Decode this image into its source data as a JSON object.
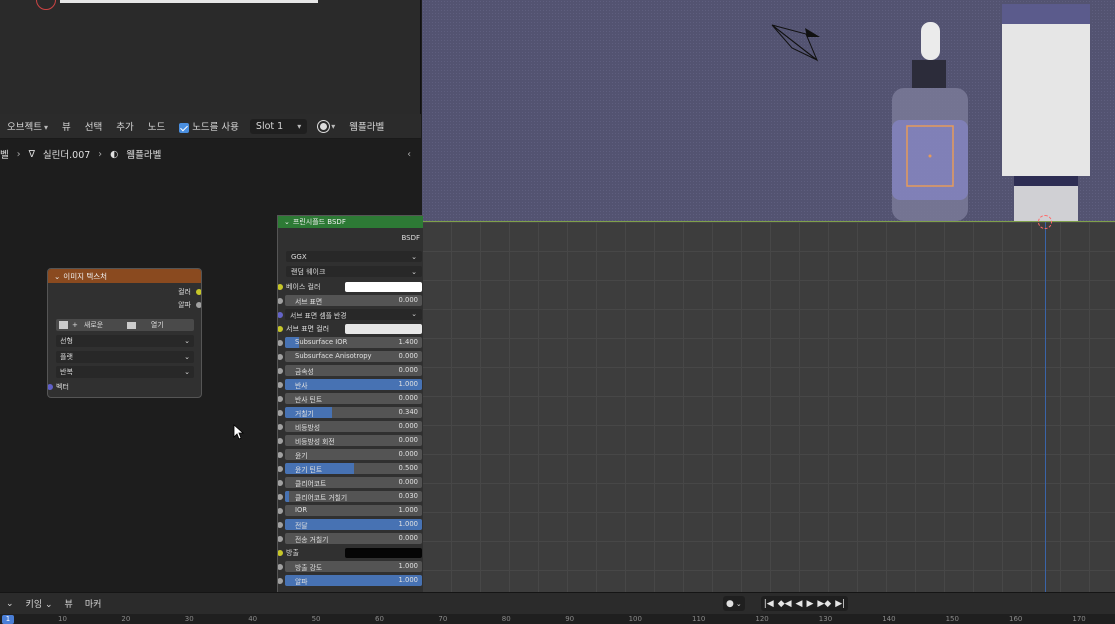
{
  "node_header": {
    "object_label": "오브젝트",
    "view": "뷰",
    "select": "선택",
    "add": "추가",
    "node": "노드",
    "use_nodes": "노드를 사용",
    "slot": "Slot 1",
    "material": "웸플라벨"
  },
  "breadcrumb": {
    "first": "벨",
    "object": "실린더.007",
    "material": "웸플라벨"
  },
  "image_texture_node": {
    "title": "이미지 텍스처",
    "out_color": "컬러",
    "out_alpha": "알파",
    "new_label": "새로운",
    "open_label": "열기",
    "interpolation": "선형",
    "projection": "플랫",
    "extension": "반복",
    "vector": "벡터"
  },
  "bsdf": {
    "title": "프린시플드 BSDF",
    "output": "BSDF",
    "distribution": "GGX",
    "subsurface_method": "랜덤 웨이크",
    "base_color": "베이스 컬러",
    "subsurface": {
      "label": "서브 표면",
      "value": "0.000",
      "fill": 0.0
    },
    "subsurface_radius": "서브 표면 셈플 반경",
    "subsurface_color": "서브 표면 컬러",
    "rows": [
      {
        "label": "Subsurface IOR",
        "value": "1.400",
        "fill": 0.1
      },
      {
        "label": "Subsurface Anisotropy",
        "value": "0.000",
        "fill": 0.0
      },
      {
        "label": "금속성",
        "value": "0.000",
        "fill": 0.0
      },
      {
        "label": "반사",
        "value": "1.000",
        "fill": 1.0
      },
      {
        "label": "반사 틴트",
        "value": "0.000",
        "fill": 0.0
      },
      {
        "label": "거칠기",
        "value": "0.340",
        "fill": 0.34
      },
      {
        "label": "비등방성",
        "value": "0.000",
        "fill": 0.0
      },
      {
        "label": "비등방성 회전",
        "value": "0.000",
        "fill": 0.0
      },
      {
        "label": "윤기",
        "value": "0.000",
        "fill": 0.0
      },
      {
        "label": "윤기 틴트",
        "value": "0.500",
        "fill": 0.5
      },
      {
        "label": "클리어코트",
        "value": "0.000",
        "fill": 0.0
      },
      {
        "label": "클리어코트 거칠기",
        "value": "0.030",
        "fill": 0.03
      },
      {
        "label": "IOR",
        "value": "1.000",
        "fill": 0.0
      },
      {
        "label": "전달",
        "value": "1.000",
        "fill": 1.0
      },
      {
        "label": "전송 거칠기",
        "value": "0.000",
        "fill": 0.0
      }
    ],
    "emission": "방출",
    "emission_strength": {
      "label": "방출 강도",
      "value": "1.000",
      "fill": 0.0
    },
    "alpha": {
      "label": "알파",
      "value": "1.000",
      "fill": 1.0
    }
  },
  "timeline": {
    "keying": "키잉",
    "view": "뷰",
    "marker": "마커",
    "current_frame": "1",
    "ticks": [
      "10",
      "20",
      "30",
      "40",
      "50",
      "60",
      "70",
      "80",
      "90",
      "100",
      "110",
      "120",
      "130",
      "140",
      "150",
      "160",
      "170"
    ]
  },
  "colors": {
    "texture_header": "#8a4a1f",
    "shader_header": "#2d7a35",
    "slider_fill": "#4772b3",
    "render_bg": "#535371"
  }
}
